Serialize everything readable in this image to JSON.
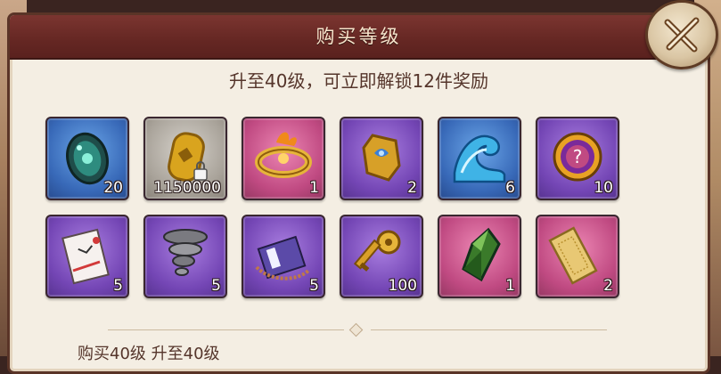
{
  "dialog": {
    "title": "购买等级",
    "subtitle": "升至40级，可立即解锁12件奖励",
    "footer": "购买40级 升至40级"
  },
  "rewards": [
    {
      "icon": "teal-orb-token-icon",
      "rarity": "blue",
      "count": "20"
    },
    {
      "icon": "gold-coin-locked-icon",
      "rarity": "gray",
      "count": "1150000"
    },
    {
      "icon": "flaming-gold-ring-icon",
      "rarity": "pink",
      "count": "1"
    },
    {
      "icon": "gold-rune-gem-icon",
      "rarity": "purple",
      "count": "2"
    },
    {
      "icon": "water-wave-icon",
      "rarity": "blue",
      "count": "6"
    },
    {
      "icon": "mystery-orb-icon",
      "rarity": "purple",
      "count": "10"
    },
    {
      "icon": "sealed-envelope-icon",
      "rarity": "purple",
      "count": "5"
    },
    {
      "icon": "gray-whirlwind-icon",
      "rarity": "purple",
      "count": "5"
    },
    {
      "icon": "scroll-book-icon",
      "rarity": "purple",
      "count": "5"
    },
    {
      "icon": "gold-key-icon",
      "rarity": "purple",
      "count": "100"
    },
    {
      "icon": "green-crystal-icon",
      "rarity": "pink",
      "count": "1"
    },
    {
      "icon": "gold-ticket-icon",
      "rarity": "pink",
      "count": "2"
    }
  ],
  "colors": {
    "header": "#652723",
    "panel": "#f4eee3",
    "text": "#55352b",
    "rarity_blue": "#3869b8",
    "rarity_gray": "#a9a39a",
    "rarity_pink": "#c04a82",
    "rarity_purple": "#7446b5"
  }
}
